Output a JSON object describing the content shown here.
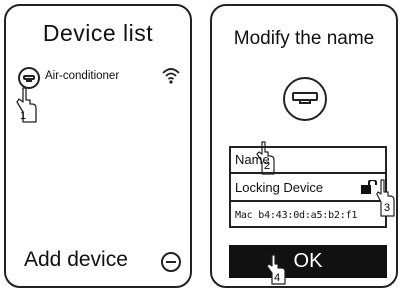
{
  "device_list": {
    "title": "Device  list",
    "device_name": "Air-conditioner",
    "add_label": "Add device"
  },
  "modify": {
    "title": "Modify the name",
    "name_label": "Name",
    "locking_label": "Locking Device",
    "mac_value": "Mac b4:43:0d:a5:b2:f1",
    "ok_label": "OK"
  },
  "callouts": [
    "1",
    "2",
    "3",
    "4"
  ],
  "icons": [
    "air-conditioner-icon",
    "wifi-icon",
    "minus-circle-icon",
    "lock-icon",
    "hand-pointer-icon"
  ],
  "colors": {
    "stroke": "#222222",
    "button": "#111111"
  }
}
